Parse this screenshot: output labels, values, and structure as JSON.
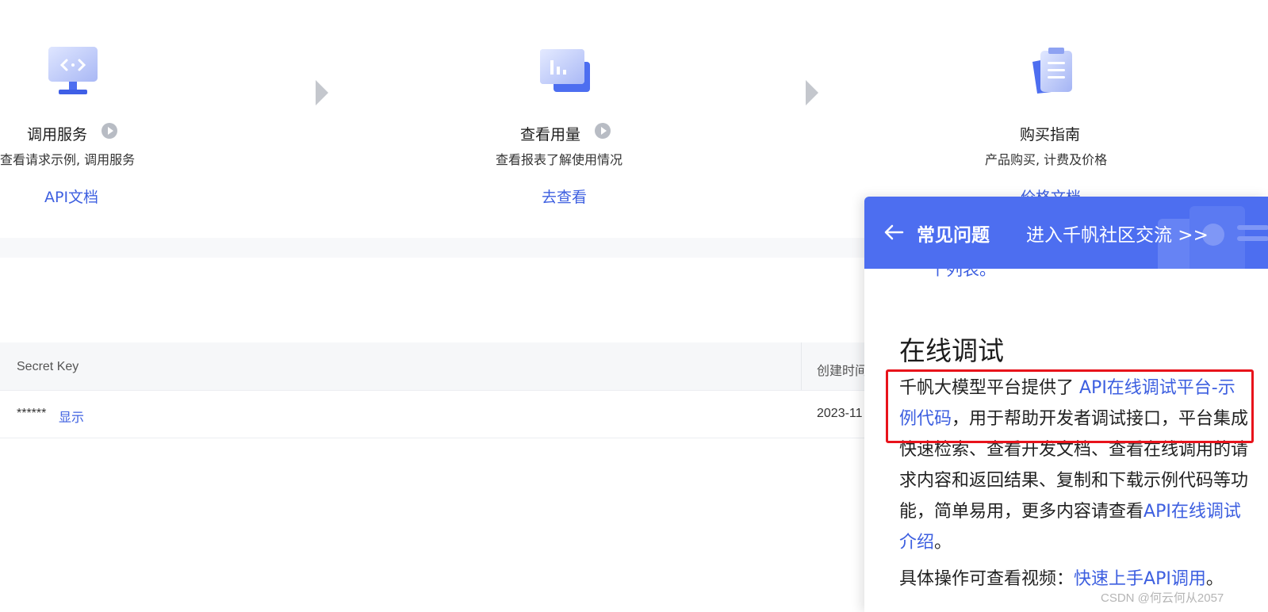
{
  "steps": [
    {
      "title": "调用服务",
      "desc": "查看请求示例, 调用服务",
      "link": "API文档",
      "icon": "monitor-code-icon",
      "has_play": true
    },
    {
      "title": "查看用量",
      "desc": "查看报表了解使用情况",
      "link": "去查看",
      "icon": "usage-chart-icon",
      "has_play": true
    },
    {
      "title": "购买指南",
      "desc": "产品购买, 计费及价格",
      "link": "价格文档",
      "icon": "clipboard-guide-icon",
      "has_play": false
    }
  ],
  "table": {
    "headers": [
      "Secret Key",
      "创建时间"
    ],
    "rows": [
      {
        "secret_mask": "******",
        "show_label": "显示",
        "created": "2023-11"
      }
    ]
  },
  "faq_panel": {
    "title": "常见问题",
    "community_link": "进入千帆社区交流 >>",
    "partial_text": "个列表。",
    "section_title": "在线调试",
    "para1_a": "千帆大模型平台提供了 ",
    "para1_link": "API在线调试平台-示例代码",
    "para1_b": "，用于帮助开发者调试接口，平台集成快速检索、查看开发文档、查看在线调用的请求内容和返回结果、复制和下载示例代码等功能，简单易用，更多内容请查看",
    "para1_link2": "API在线调试介绍",
    "para1_end": "。",
    "para2_a": "具体操作可查看视频：",
    "para2_link": "快速上手API调用",
    "para2_end": "。"
  },
  "watermark": "CSDN @何云何从2057",
  "colors": {
    "accent": "#3d5fe0",
    "header_blue": "#4d6ef0",
    "highlight_red": "#e8131b"
  }
}
